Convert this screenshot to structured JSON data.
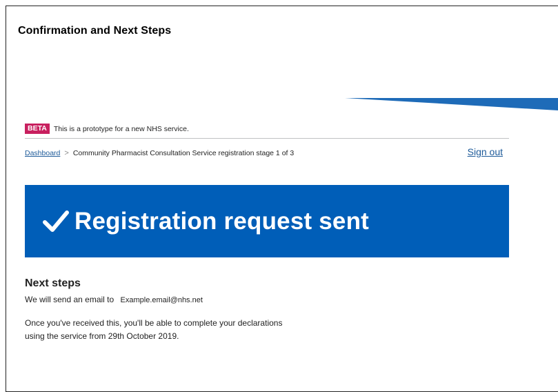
{
  "slide": {
    "title": "Confirmation and Next Steps"
  },
  "beta": {
    "tag": "BETA",
    "text": "This is a prototype for a new NHS service."
  },
  "breadcrumb": {
    "link": "Dashboard",
    "separator": ">",
    "current": "Community Pharmacist Consultation Service registration stage 1 of 3"
  },
  "header": {
    "sign_out": "Sign out"
  },
  "banner": {
    "icon": "check-icon",
    "title": "Registration request sent",
    "color": "#005eb8"
  },
  "next_steps": {
    "heading": "Next steps",
    "email_prefix": "We will send an email to",
    "email": "Example.email@nhs.net",
    "line1": "Once you've received this, you'll be able to complete your declarations",
    "line2": "using the service from 29th October 2019."
  },
  "colors": {
    "beta": "#c8205f",
    "link": "#1d5a99",
    "nhs_blue": "#005eb8"
  }
}
